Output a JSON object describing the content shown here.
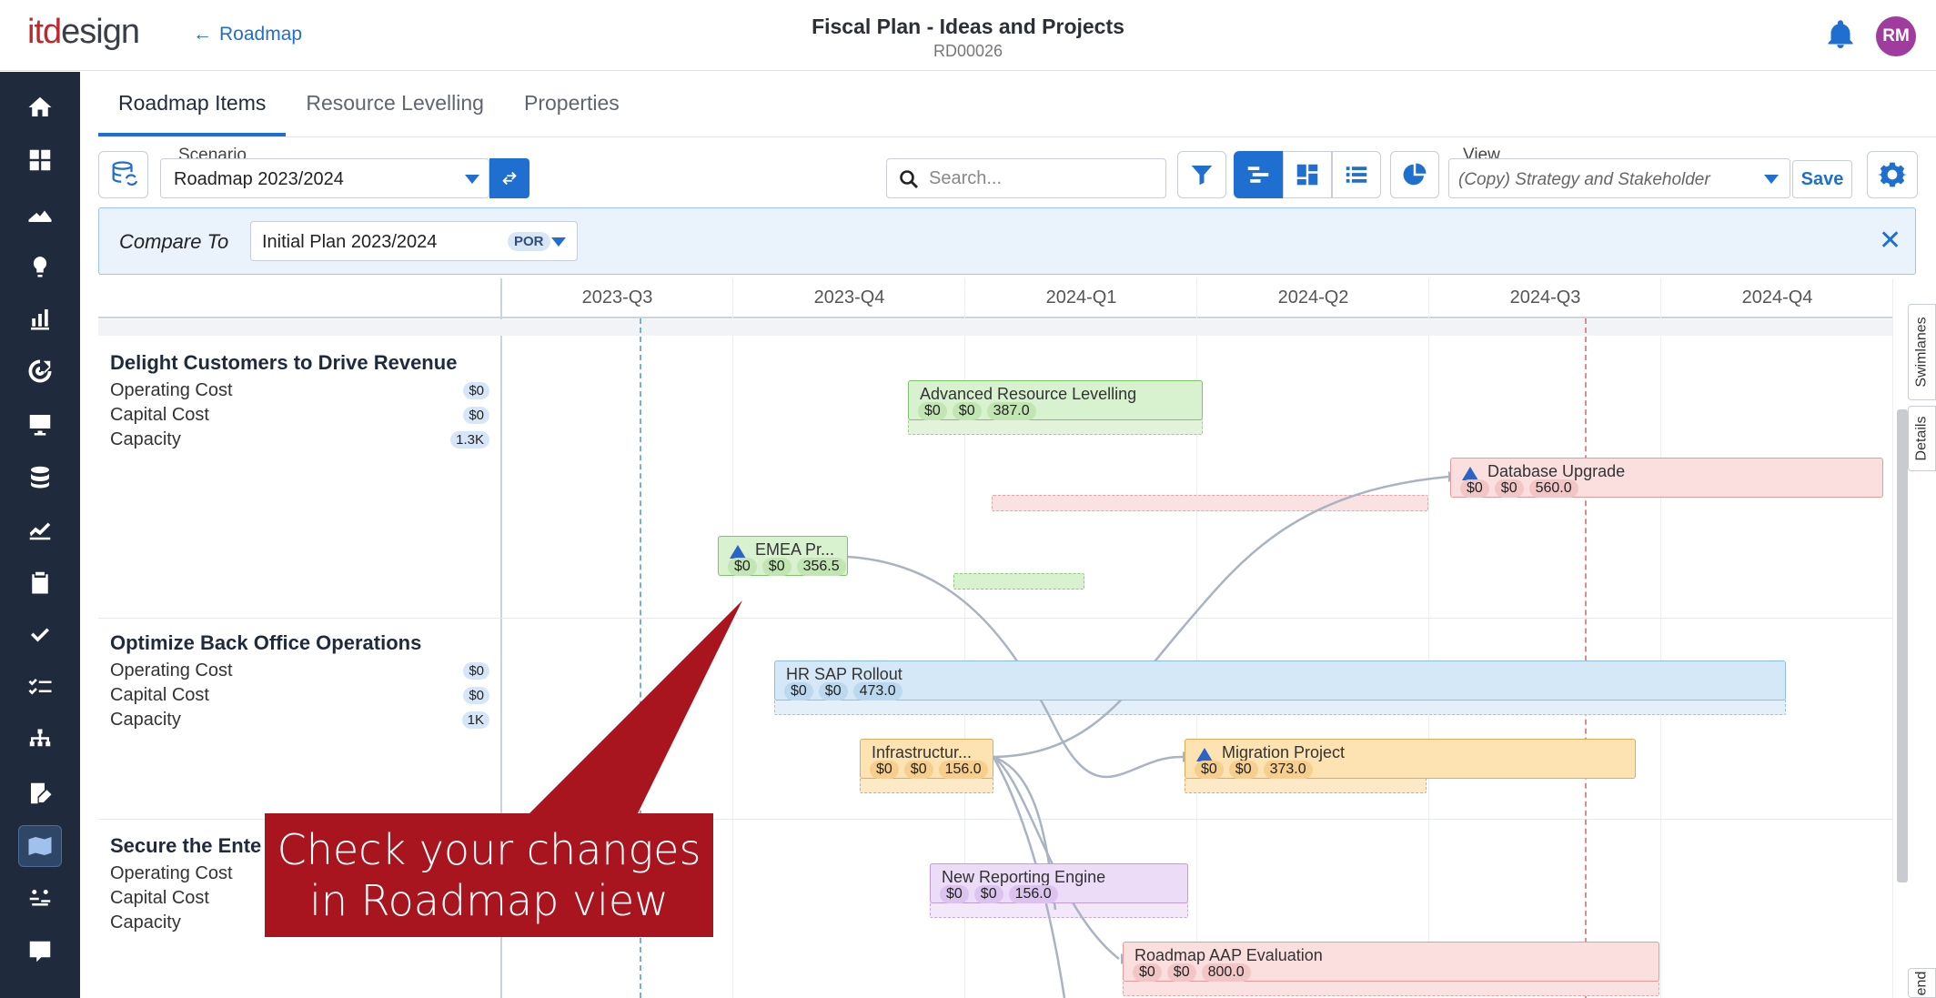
{
  "app": {
    "logo_it": "itd",
    "logo_rest": "esign",
    "back_label": "Roadmap",
    "title": "Fiscal Plan - Ideas and Projects",
    "subtitle": "RD00026",
    "avatar_initials": "RM"
  },
  "tabs": [
    {
      "label": "Roadmap Items",
      "active": true
    },
    {
      "label": "Resource Levelling",
      "active": false
    },
    {
      "label": "Properties",
      "active": false
    }
  ],
  "toolbar": {
    "scenario_label": "Scenario",
    "scenario_value": "Roadmap 2023/2024",
    "search_placeholder": "Search...",
    "view_label": "View",
    "view_value": "(Copy) Strategy and Stakeholder",
    "save_label": "Save"
  },
  "compare": {
    "label": "Compare To",
    "value": "Initial Plan 2023/2024",
    "badge": "POR"
  },
  "quarters": [
    "2023-Q3",
    "2023-Q4",
    "2024-Q1",
    "2024-Q2",
    "2024-Q3",
    "2024-Q4"
  ],
  "swimlanes": [
    {
      "title": "Delight Customers to Drive Revenue",
      "rows": [
        {
          "label": "Operating Cost",
          "value": "$0"
        },
        {
          "label": "Capital Cost",
          "value": "$0"
        },
        {
          "label": "Capacity",
          "value": "1.3K"
        }
      ]
    },
    {
      "title": "Optimize Back Office Operations",
      "rows": [
        {
          "label": "Operating Cost",
          "value": "$0"
        },
        {
          "label": "Capital Cost",
          "value": "$0"
        },
        {
          "label": "Capacity",
          "value": "1K"
        }
      ]
    },
    {
      "title": "Secure the Ente",
      "rows": [
        {
          "label": "Operating Cost",
          "value": ""
        },
        {
          "label": "Capital Cost",
          "value": ""
        },
        {
          "label": "Capacity",
          "value": ""
        }
      ]
    }
  ],
  "items": [
    {
      "name": "Advanced Resource Levelling",
      "v1": "$0",
      "v2": "$0",
      "v3": "387.0"
    },
    {
      "name": "Database Upgrade",
      "v1": "$0",
      "v2": "$0",
      "v3": "560.0"
    },
    {
      "name": "EMEA Pr...",
      "v1": "$0",
      "v2": "$0",
      "v3": "356.5"
    },
    {
      "name": "HR SAP Rollout",
      "v1": "$0",
      "v2": "$0",
      "v3": "473.0"
    },
    {
      "name": "Infrastructur...",
      "v1": "$0",
      "v2": "$0",
      "v3": "156.0"
    },
    {
      "name": "Migration Project",
      "v1": "$0",
      "v2": "$0",
      "v3": "373.0"
    },
    {
      "name": "New Reporting Engine",
      "v1": "$0",
      "v2": "$0",
      "v3": "156.0"
    },
    {
      "name": "Roadmap AAP Evaluation",
      "v1": "$0",
      "v2": "$0",
      "v3": "800.0"
    }
  ],
  "side_tabs": {
    "swimlanes": "Swimlanes",
    "details": "Details",
    "legend_partial": "end"
  },
  "callout": {
    "line1": "Check your changes",
    "line2": "in Roadmap view"
  },
  "colors": {
    "accent": "#1e6fd0",
    "nav": "#1f2b3c",
    "brand_red": "#c0282d",
    "callout": "#a8151e"
  }
}
